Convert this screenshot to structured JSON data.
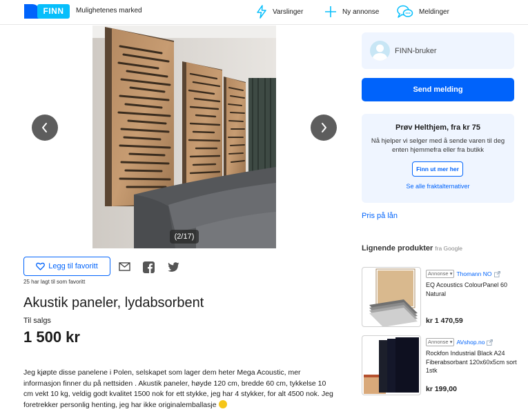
{
  "header": {
    "logo_text": "FINN",
    "tagline": "Mulighetenes marked",
    "nav": {
      "alerts": "Varslinger",
      "new_ad": "Ny annonse",
      "messages": "Meldinger"
    }
  },
  "gallery": {
    "counter": "(2/17)",
    "current": 2,
    "total": 17
  },
  "favorite": {
    "button_label": "Legg til favoritt",
    "count_text": "25 har lagt til som favoritt"
  },
  "listing": {
    "title": "Akustik paneler, lydabsorbent",
    "status": "Til salgs",
    "price": "1 500 kr",
    "description": "Jeg kjøpte disse panelene i Polen, selskapet som lager dem heter Mega Acoustic, mer informasjon finner du på nettsiden . Akustik paneler, høyde 120 cm, bredde 60 cm, tykkelse 10 cm vekt 10 kg, veldig godt kvalitet 1500 nok for ett stykke, jeg har 4 stykker, for alt 4500 nok. Jeg foretrekker personlig henting, jeg har ikke originalemballasje"
  },
  "seller": {
    "name": "FINN-bruker",
    "send_button": "Send melding"
  },
  "helthjem": {
    "title": "Prøv Helthjem, fra kr 75",
    "text": "Nå hjelper vi selger med å sende varen til deg enten hjemmefra eller fra butikk",
    "button": "Finn ut mer her",
    "link": "Se alle fraktalternativer"
  },
  "loan_link": "Pris på lån",
  "similar": {
    "heading": "Lignende produkter",
    "source": "fra Google",
    "products": [
      {
        "ad_label": "Annonse ▾",
        "shop": "Thomann NO",
        "name": "EQ Acoustics ColourPanel 60 Natural",
        "price": "kr 1 470,59"
      },
      {
        "ad_label": "Annonse ▾",
        "shop": "AVshop.no",
        "name": "Rockfon Industrial Black A24 Fiberabsorbant 120x60x5cm sort 1stk",
        "price": "kr 199,00"
      }
    ]
  },
  "colors": {
    "brand_blue": "#0063fb",
    "brand_cyan": "#06befb",
    "card_bg": "#eff5ff"
  }
}
